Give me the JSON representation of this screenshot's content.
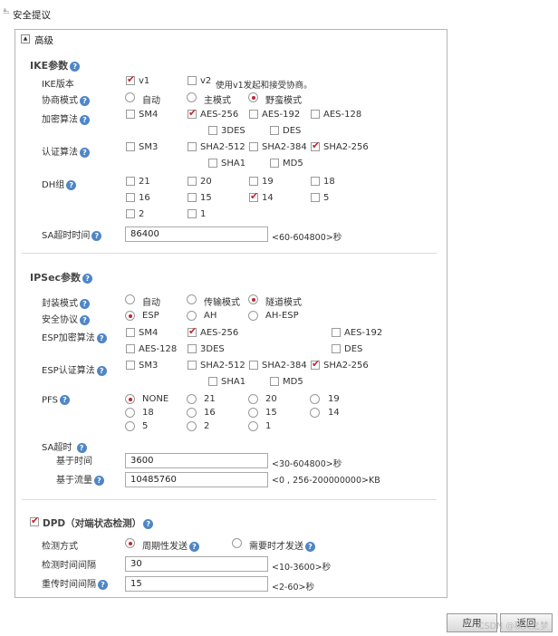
{
  "page": {
    "title": "安全提议"
  },
  "panel": {
    "title": "高级",
    "collapse_glyph": "▲"
  },
  "help_glyph": "?",
  "ike": {
    "title": "IKE参数",
    "version": {
      "label": "IKE版本",
      "v1": "v1",
      "v2": "v2",
      "note": "使用v1发起和接受协商。"
    },
    "mode": {
      "label": "协商模式",
      "options": [
        "自动",
        "主模式",
        "野蛮模式"
      ],
      "selected": "野蛮模式"
    },
    "encryption": {
      "label": "加密算法",
      "options": [
        "SM4",
        "AES-256",
        "AES-192",
        "AES-128",
        "3DES",
        "DES"
      ],
      "checked": [
        "AES-256"
      ]
    },
    "auth": {
      "label": "认证算法",
      "options": [
        "SM3",
        "SHA2-512",
        "SHA2-384",
        "SHA2-256",
        "SHA1",
        "MD5"
      ],
      "checked": [
        "SHA2-256"
      ]
    },
    "dh": {
      "label": "DH组",
      "options": [
        "21",
        "20",
        "19",
        "18",
        "16",
        "15",
        "14",
        "5",
        "2",
        "1"
      ],
      "checked": [
        "14"
      ]
    },
    "sa_timeout": {
      "label": "SA超时时间",
      "value": "86400",
      "hint": "<60-604800>秒"
    }
  },
  "ipsec": {
    "title": "IPSec参数",
    "encap": {
      "label": "封装模式",
      "options": [
        "自动",
        "传输模式",
        "隧道模式"
      ],
      "selected": "隧道模式"
    },
    "protocol": {
      "label": "安全协议",
      "options": [
        "ESP",
        "AH",
        "AH-ESP"
      ],
      "selected": "ESP"
    },
    "esp_enc": {
      "label": "ESP加密算法",
      "options": [
        "SM4",
        "AES-256",
        "AES-192",
        "AES-128",
        "3DES",
        "DES"
      ],
      "checked": [
        "AES-256"
      ]
    },
    "esp_auth": {
      "label": "ESP认证算法",
      "options": [
        "SM3",
        "SHA2-512",
        "SHA2-384",
        "SHA2-256",
        "SHA1",
        "MD5"
      ],
      "checked": [
        "SHA2-256"
      ]
    },
    "pfs": {
      "label": "PFS",
      "options": [
        "NONE",
        "21",
        "20",
        "19",
        "18",
        "16",
        "15",
        "14",
        "5",
        "2",
        "1"
      ],
      "selected": "NONE"
    },
    "sa_timeout": {
      "label": "SA超时",
      "time": {
        "label": "基于时间",
        "value": "3600",
        "hint": "<30-604800>秒"
      },
      "traffic": {
        "label": "基于流量",
        "value": "10485760",
        "hint": "<0 , 256-200000000>KB"
      }
    }
  },
  "dpd": {
    "title": "DPD（对端状态检测）",
    "enabled": true,
    "method": {
      "label": "检测方式",
      "options": [
        "周期性发送",
        "需要时才发送"
      ],
      "selected": "周期性发送"
    },
    "interval": {
      "label": "检测时间间隔",
      "value": "30",
      "hint": "<10-3600>秒"
    },
    "retry": {
      "label": "重传时间间隔",
      "value": "15",
      "hint": "<2-60>秒"
    }
  },
  "buttons": {
    "apply": "应用",
    "back": "返回"
  },
  "watermark": "CSDN @秋天之梦"
}
